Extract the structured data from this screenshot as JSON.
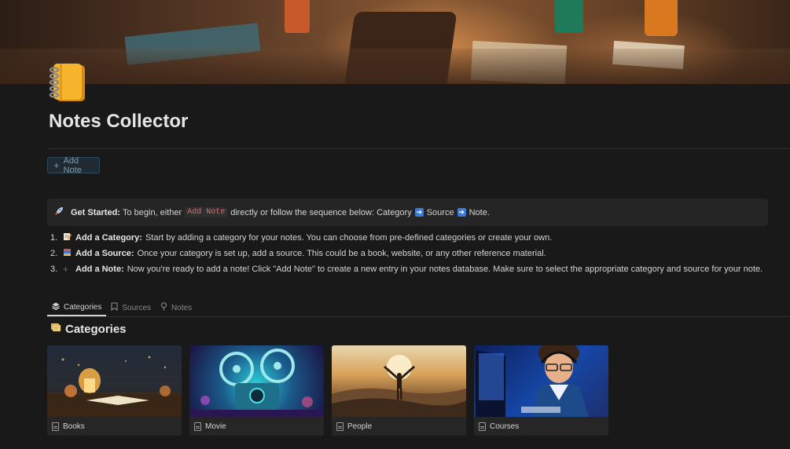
{
  "page": {
    "title": "Notes Collector",
    "add_note_label": "Add Note"
  },
  "callout": {
    "lead": "Get Started:",
    "text_before": "To begin, either",
    "code": "Add Note",
    "text_after": "directly or follow the sequence below: Category",
    "step2": "Source",
    "step3": "Note."
  },
  "steps": [
    {
      "num": "1.",
      "title": "Add a Category:",
      "text": "Start by adding a category for your notes. You can choose from pre-defined categories or create your own."
    },
    {
      "num": "2.",
      "title": "Add a Source:",
      "text": "Once your category is set up, add a source. This could be a book, website, or any other reference material."
    },
    {
      "num": "3.",
      "title": "Add a Note:",
      "text": "Now you're ready to add a note! Click \"Add Note\" to create a new entry in your notes database. Make sure to select the appropriate category and source for your note."
    }
  ],
  "tabs": [
    {
      "label": "Categories",
      "icon": "layers-icon",
      "active": true
    },
    {
      "label": "Sources",
      "icon": "bookmark-icon",
      "active": false
    },
    {
      "label": "Notes",
      "icon": "pin-icon",
      "active": false
    }
  ],
  "section_title": "Categories",
  "cards": [
    {
      "label": "Books"
    },
    {
      "label": "Movie"
    },
    {
      "label": "People"
    },
    {
      "label": "Courses"
    }
  ],
  "colors": {
    "background": "#191919",
    "callout_bg": "#252525",
    "code_text": "#e06c6c",
    "accent_blue": "#3a7bd5"
  }
}
